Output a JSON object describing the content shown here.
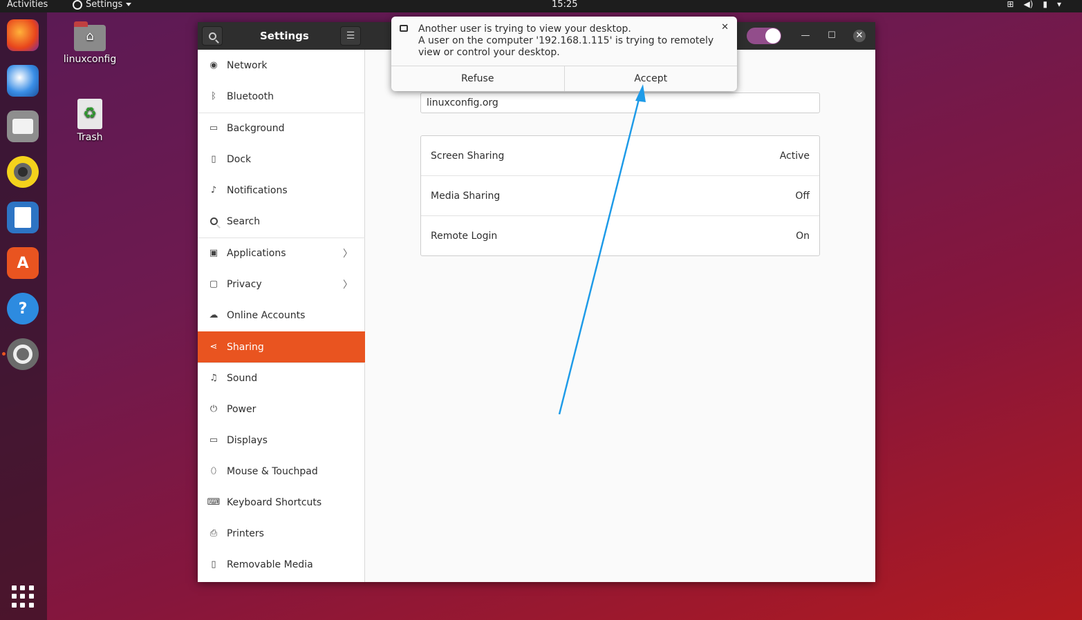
{
  "topbar": {
    "activities": "Activities",
    "app_menu": "Settings",
    "clock": "15:25"
  },
  "desktop": {
    "home_label": "linuxconfig",
    "trash_label": "Trash"
  },
  "dock": {
    "items": [
      "firefox-icon",
      "thunderbird-icon",
      "files-icon",
      "rhythmbox-icon",
      "libreoffice-writer-icon",
      "software-icon",
      "help-icon",
      "settings-icon"
    ]
  },
  "window": {
    "title": "Settings",
    "sidebar": [
      {
        "label": "Network",
        "icon": "network-icon"
      },
      {
        "label": "Bluetooth",
        "icon": "bluetooth-icon"
      },
      {
        "label": "Background",
        "icon": "background-icon"
      },
      {
        "label": "Dock",
        "icon": "dock-icon"
      },
      {
        "label": "Notifications",
        "icon": "bell-icon"
      },
      {
        "label": "Search",
        "icon": "search-icon"
      },
      {
        "label": "Applications",
        "icon": "applications-icon"
      },
      {
        "label": "Privacy",
        "icon": "lock-icon"
      },
      {
        "label": "Online Accounts",
        "icon": "cloud-icon"
      },
      {
        "label": "Sharing",
        "icon": "share-icon"
      },
      {
        "label": "Sound",
        "icon": "music-note-icon"
      },
      {
        "label": "Power",
        "icon": "power-icon"
      },
      {
        "label": "Displays",
        "icon": "display-icon"
      },
      {
        "label": "Mouse & Touchpad",
        "icon": "mouse-icon"
      },
      {
        "label": "Keyboard Shortcuts",
        "icon": "keyboard-icon"
      },
      {
        "label": "Printers",
        "icon": "printer-icon"
      },
      {
        "label": "Removable Media",
        "icon": "media-icon"
      }
    ],
    "active_item": "Sharing",
    "computer_name": "linuxconfig.org",
    "sharing": [
      {
        "name": "Screen Sharing",
        "state": "Active"
      },
      {
        "name": "Media Sharing",
        "state": "Off"
      },
      {
        "name": "Remote Login",
        "state": "On"
      }
    ]
  },
  "notification": {
    "title": "Another user is trying to view your desktop.",
    "body": "A user on the computer '192.168.1.115' is trying to remotely view or control your desktop.",
    "refuse": "Refuse",
    "accept": "Accept"
  },
  "colors": {
    "accent": "#e95420",
    "arrow": "#1e9be8"
  }
}
